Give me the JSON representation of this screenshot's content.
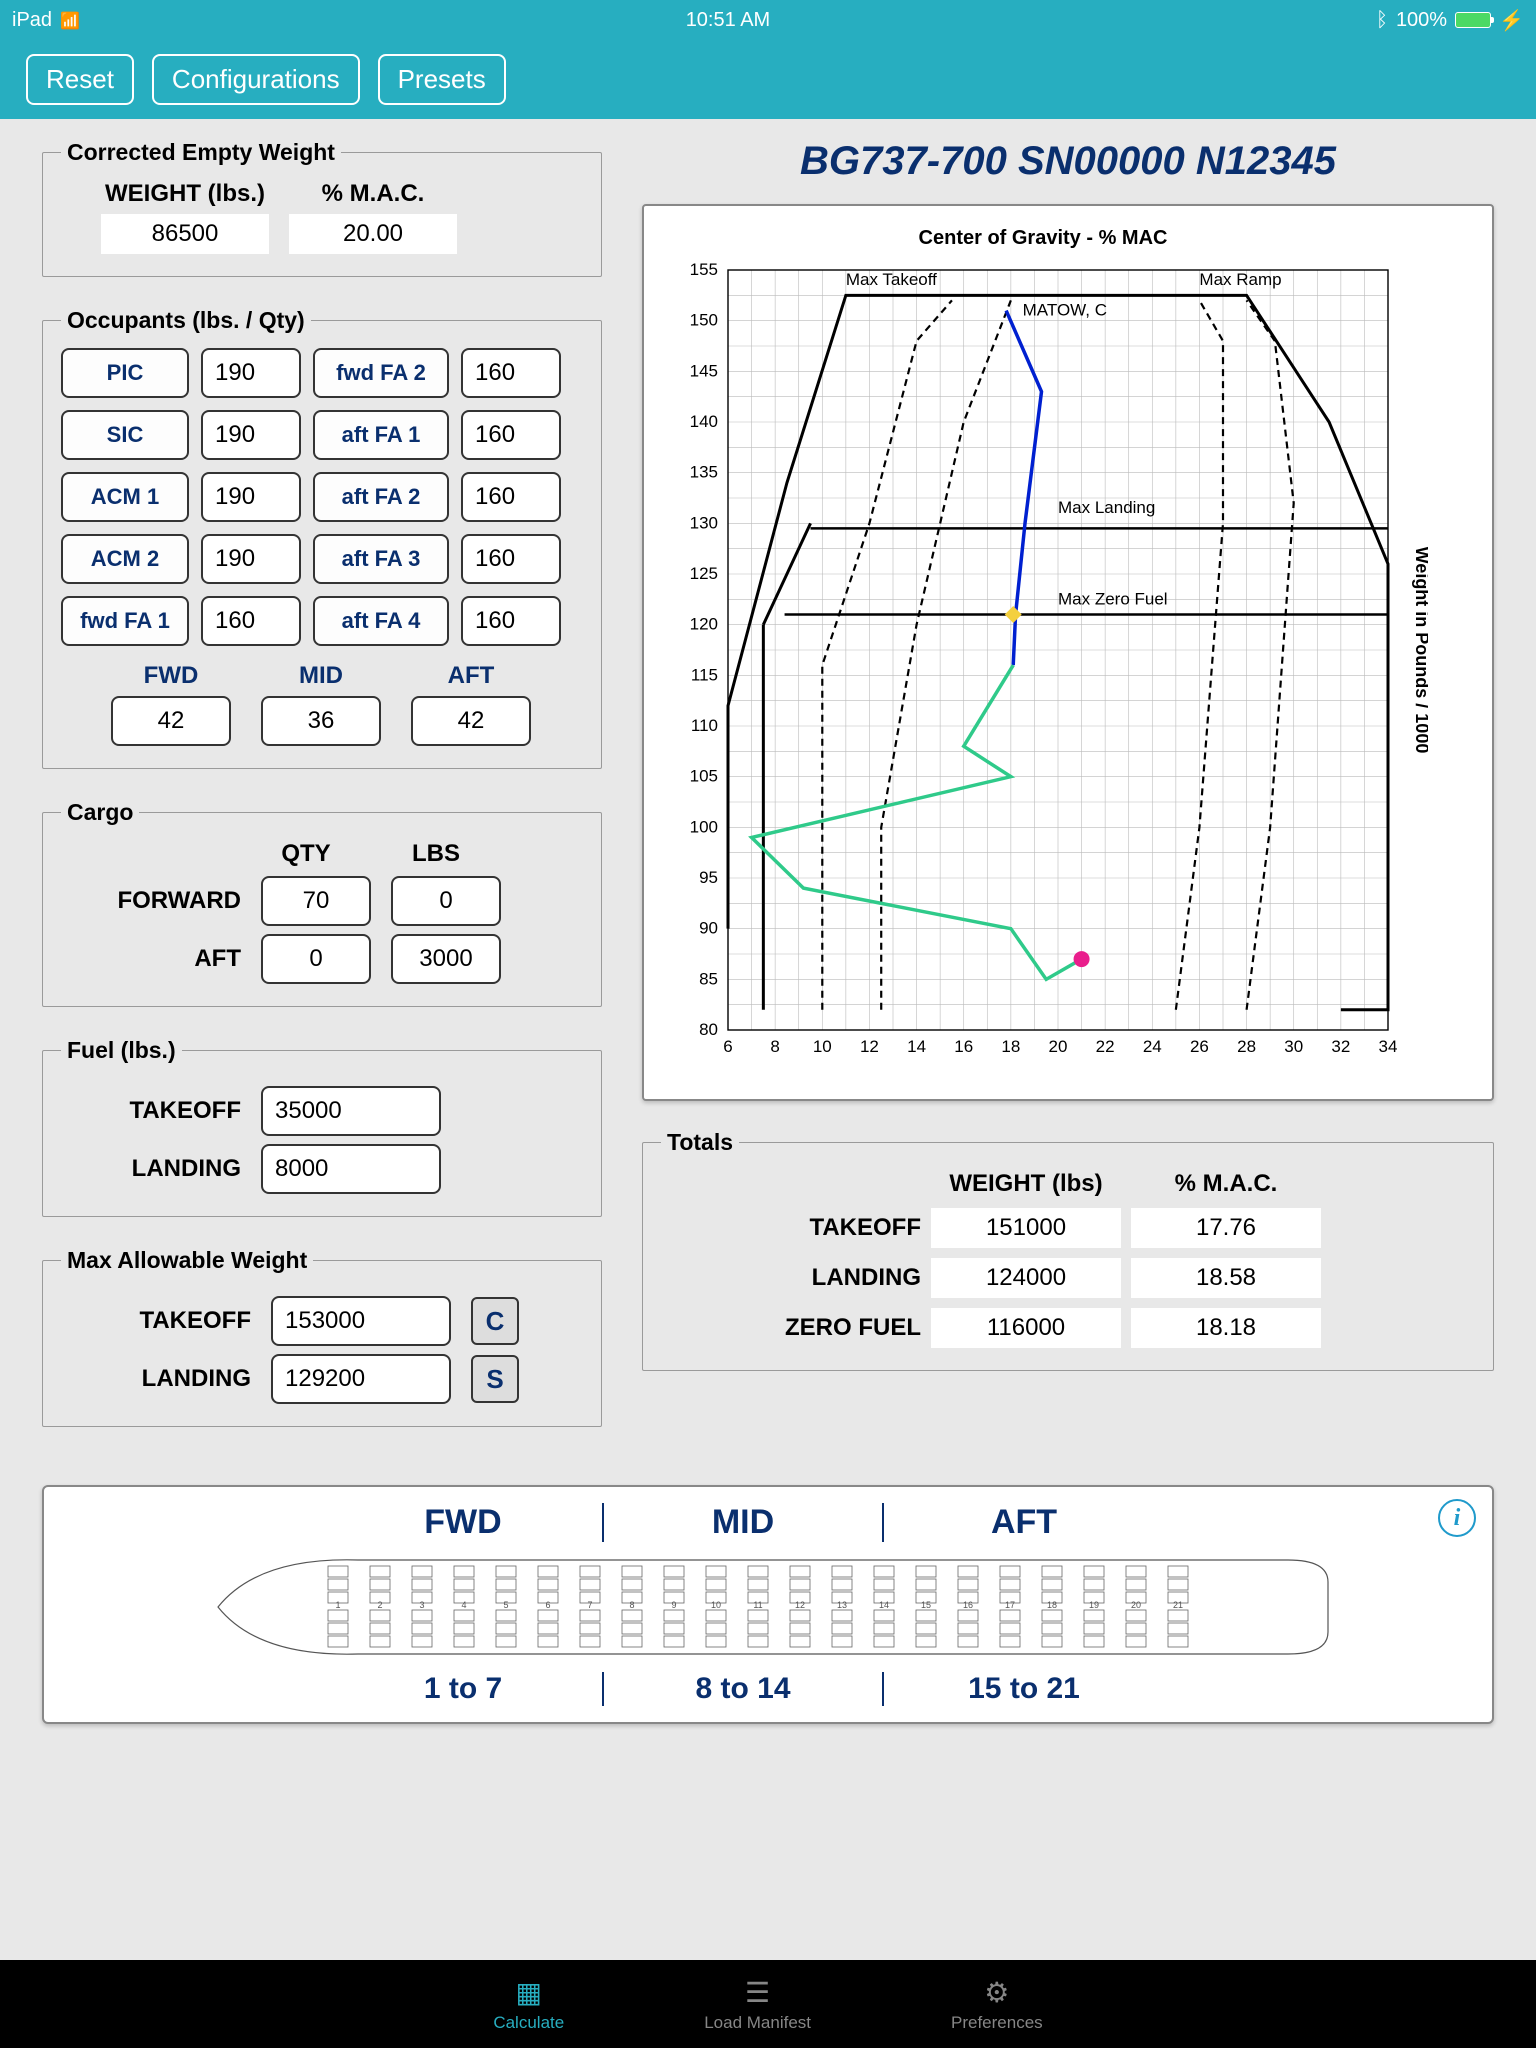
{
  "status": {
    "device": "iPad",
    "time": "10:51 AM",
    "batt": "100%"
  },
  "header": {
    "reset": "Reset",
    "config": "Configurations",
    "presets": "Presets"
  },
  "title": "BG737-700 SN00000 N12345",
  "cew": {
    "legend": "Corrected Empty Weight",
    "h1": "WEIGHT (lbs.)",
    "h2": "% M.A.C.",
    "weight": "86500",
    "mac": "20.00"
  },
  "occ": {
    "legend": "Occupants (lbs. / Qty)",
    "rows": [
      {
        "l1": "PIC",
        "v1": "190",
        "l2": "fwd FA 2",
        "v2": "160"
      },
      {
        "l1": "SIC",
        "v1": "190",
        "l2": "aft FA 1",
        "v2": "160"
      },
      {
        "l1": "ACM 1",
        "v1": "190",
        "l2": "aft FA 2",
        "v2": "160"
      },
      {
        "l1": "ACM 2",
        "v1": "190",
        "l2": "aft FA 3",
        "v2": "160"
      },
      {
        "l1": "fwd FA 1",
        "v1": "160",
        "l2": "aft FA 4",
        "v2": "160"
      }
    ],
    "bh": {
      "fwd": "FWD",
      "mid": "MID",
      "aft": "AFT"
    },
    "bv": {
      "fwd": "42",
      "mid": "36",
      "aft": "42"
    }
  },
  "cargo": {
    "legend": "Cargo",
    "hq": "QTY",
    "hl": "LBS",
    "fwdlbl": "FORWARD",
    "fwdq": "70",
    "fwdl": "0",
    "aftlbl": "AFT",
    "aftq": "0",
    "aftl": "3000"
  },
  "fuel": {
    "legend": "Fuel (lbs.)",
    "tolbl": "TAKEOFF",
    "to": "35000",
    "lalbl": "LANDING",
    "la": "8000"
  },
  "maw": {
    "legend": "Max Allowable Weight",
    "tolbl": "TAKEOFF",
    "to": "153000",
    "lalbl": "LANDING",
    "la": "129200",
    "c": "C",
    "s": "S"
  },
  "chart": {
    "title": "Center of Gravity - % MAC",
    "ylabel": "Weight in Pounds / 1000",
    "lbl1": "Max Takeoff",
    "lbl2": "Max Ramp",
    "lbl3": "MATOW, C",
    "lbl4": "Max Landing",
    "lbl5": "Max Zero Fuel"
  },
  "totals": {
    "legend": "Totals",
    "h1": "WEIGHT (lbs)",
    "h2": "% M.A.C.",
    "r1l": "TAKEOFF",
    "r1w": "151000",
    "r1m": "17.76",
    "r2l": "LANDING",
    "r2w": "124000",
    "r2m": "18.58",
    "r3l": "ZERO FUEL",
    "r3w": "116000",
    "r3m": "18.18"
  },
  "seat": {
    "h1": "FWD",
    "h2": "MID",
    "h3": "AFT",
    "f1": "1 to 7",
    "f2": "8 to 14",
    "f3": "15 to 21"
  },
  "tabs": {
    "calc": "Calculate",
    "lm": "Load Manifest",
    "pref": "Preferences"
  },
  "chart_data": {
    "type": "line",
    "xlabel": "Center of Gravity - % MAC",
    "ylabel": "Weight in Pounds / 1000",
    "xlim": [
      6,
      34
    ],
    "ylim": [
      80,
      155
    ],
    "series": [
      {
        "name": "Blue line",
        "color": "#0020d0",
        "points": [
          [
            17.8,
            151
          ],
          [
            19.3,
            143
          ],
          [
            18.6,
            130
          ],
          [
            18.2,
            121
          ],
          [
            18.1,
            116
          ]
        ]
      },
      {
        "name": "Green line",
        "color": "#2fca8a",
        "points": [
          [
            18.1,
            116
          ],
          [
            16.0,
            108
          ],
          [
            18.0,
            105
          ],
          [
            7.0,
            99
          ],
          [
            9.2,
            94
          ],
          [
            18.0,
            90
          ],
          [
            19.5,
            85
          ],
          [
            21.0,
            87
          ]
        ]
      }
    ],
    "annotations": [
      {
        "text": "Max Takeoff",
        "x": 11,
        "y": 153.5
      },
      {
        "text": "Max Ramp",
        "x": 26,
        "y": 153.5
      },
      {
        "text": "MATOW, C",
        "x": 18.5,
        "y": 150.5
      },
      {
        "text": "Max Landing",
        "x": 20,
        "y": 131
      },
      {
        "text": "Max Zero Fuel",
        "x": 20,
        "y": 122
      }
    ],
    "markers": [
      {
        "x": 18.1,
        "y": 121,
        "color": "#f4d03f",
        "shape": "diamond"
      },
      {
        "x": 21,
        "y": 87,
        "color": "#e91e8c",
        "shape": "circle"
      }
    ]
  }
}
